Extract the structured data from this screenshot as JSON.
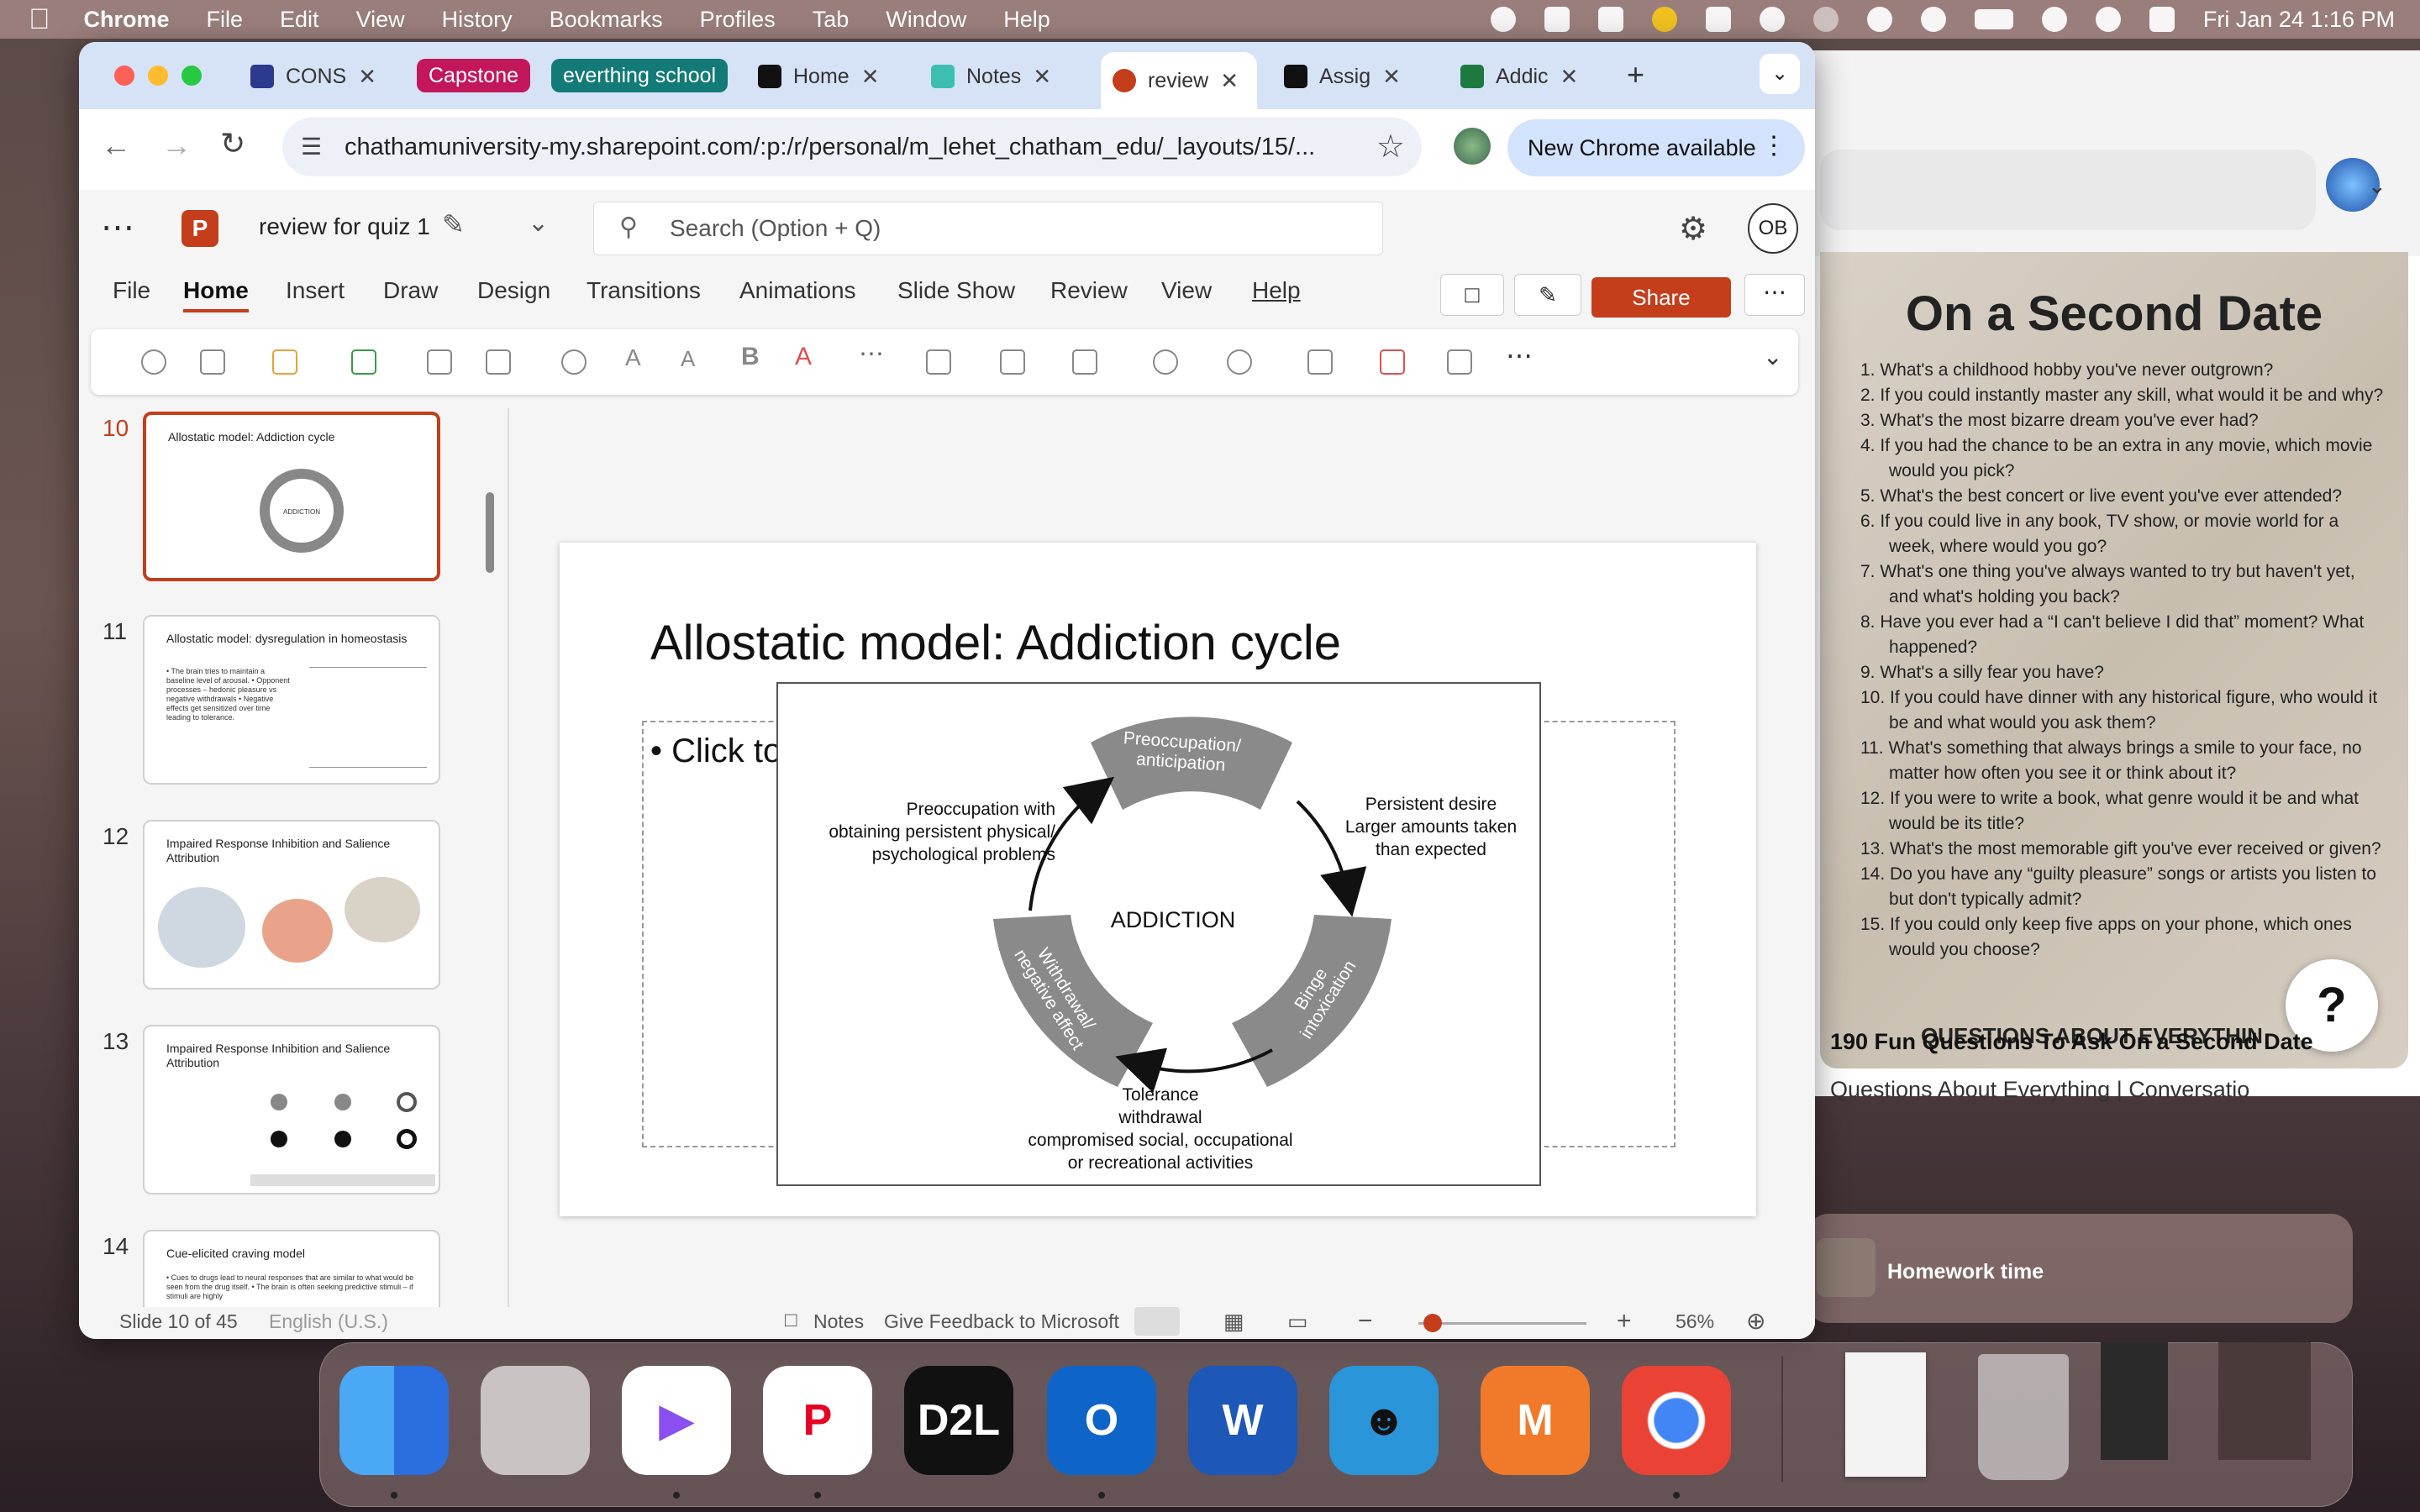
{
  "menubar": {
    "app": "Chrome",
    "items": [
      "File",
      "Edit",
      "View",
      "History",
      "Bookmarks",
      "Profiles",
      "Tab",
      "Window",
      "Help"
    ],
    "clock": "Fri Jan 24  1:16 PM"
  },
  "browser": {
    "tabs": [
      {
        "label": "CONS",
        "color": "#2b3a8c"
      },
      {
        "label": "Home",
        "color": "#111111"
      },
      {
        "label": "Notes",
        "color": "#3cbfb0"
      },
      {
        "label": "review",
        "color": "#c43e1c",
        "active": true
      },
      {
        "label": "Assig",
        "color": "#111111"
      },
      {
        "label": "Addic",
        "color": "#1d7a3f"
      }
    ],
    "groups": [
      {
        "label": "Capstone",
        "color": "#c2185b"
      },
      {
        "label": "everthing school",
        "color": "#127a77"
      }
    ],
    "url": "chathamuniversity-my.sharepoint.com/:p:/r/personal/m_lehet_chatham_edu/_layouts/15/...",
    "new_chrome": "New Chrome available"
  },
  "ppt": {
    "doc_title": "review for quiz 1",
    "search_placeholder": "Search (Option + Q)",
    "user_initials": "OB",
    "ribbon_tabs": [
      "File",
      "Home",
      "Insert",
      "Draw",
      "Design",
      "Transitions",
      "Animations",
      "Slide Show",
      "Review",
      "View",
      "Help"
    ],
    "share_label": "Share",
    "thumbnails": [
      {
        "num": "10",
        "title": "Allostatic model: Addiction cycle",
        "selected": true
      },
      {
        "num": "11",
        "title": "Allostatic model: dysregulation in homeostasis",
        "body": "• The brain tries to maintain a baseline level of arousal. • Opponent processes – hedonic pleasure vs negative withdrawals • Negative effects get sensitized over time leading to tolerance."
      },
      {
        "num": "12",
        "title": "Impaired Response Inhibition and Salience Attribution"
      },
      {
        "num": "13",
        "title": "Impaired Response Inhibition and Salience Attribution"
      },
      {
        "num": "14",
        "title": "Cue-elicited craving model",
        "body": "• Cues to drugs lead to neural responses that are similar to what would be seen from the drug itself. • The brain is often seeking predictive stimuli – if stimuli are highly"
      }
    ],
    "slide": {
      "title": "Allostatic model: Addiction cycle",
      "bullet": "• Click to",
      "diagram": {
        "center": "ADDICTION",
        "stage1": "Preoccupation/ anticipation",
        "stage2": "Binge intoxication",
        "stage3": "Withdrawal/ negative affect",
        "left_note": [
          "Preoccupation with",
          "obtaining persistent physical/",
          "psychological problems"
        ],
        "right_note": [
          "Persistent desire",
          "Larger amounts taken",
          "than expected"
        ],
        "bottom_note": [
          "Tolerance",
          "withdrawal",
          "compromised social, occupational",
          "or recreational activities"
        ]
      }
    },
    "status": {
      "slide_info": "Slide 10 of 45",
      "language": "English (U.S.)",
      "notes": "Notes",
      "feedback": "Give Feedback to Microsoft",
      "zoom": "56%"
    }
  },
  "side": {
    "image_title": "On a Second Date",
    "questions": [
      "1. What's a childhood hobby you've never outgrown?",
      "2. If you could instantly master any skill, what would it be and why?",
      "3. What's the most bizarre dream you've ever had?",
      "4. If you had the chance to be an extra in any movie, which movie would you pick?",
      "5. What's the best concert or live event you've ever attended?",
      "6. If you could live in any book, TV show, or movie world for a week, where would you go?",
      "7. What's one thing you've always wanted to try but haven't yet, and what's holding you back?",
      "8. Have you ever had a “I can't believe I did that” moment? What happened?",
      "9. What's a silly fear you have?",
      "10. If you could have dinner with any historical figure, who would it be and what would you ask them?",
      "11. What's something that always brings a smile to your face, no matter how often you see it or think about it?",
      "12. If you were to write a book, what genre would it be and what would be its title?",
      "13. What's the most memorable gift you've ever received or given?",
      "14. Do you have any “guilty pleasure” songs or artists you listen to but don't typically admit?",
      "15. If you could only keep five apps on your phone, which ones would you choose?"
    ],
    "image_footer": "QUESTIONS ABOUT EVERYTHIN",
    "help": "?",
    "caption": "190 Fun Questions To Ask On a Second Date",
    "caption_source": "Questions About Everything | Conversatio",
    "music_title": "Homework time"
  },
  "dock": {
    "apps": [
      {
        "name": "finder",
        "color": "#3a8ef0"
      },
      {
        "name": "launchpad",
        "color": "#c9c3c3"
      },
      {
        "name": "play",
        "color": "#ffffff"
      },
      {
        "name": "pinterest",
        "color": "#ffffff"
      },
      {
        "name": "d2l",
        "color": "#111111",
        "label": "D2L"
      },
      {
        "name": "outlook",
        "color": "#0f64c8",
        "label": "O"
      },
      {
        "name": "word",
        "color": "#1d57b8",
        "label": "W"
      },
      {
        "name": "kindle",
        "color": "#2a95d8"
      },
      {
        "name": "music",
        "color": "#f07a2a"
      },
      {
        "name": "chrome",
        "color": "#ffffff"
      }
    ]
  }
}
